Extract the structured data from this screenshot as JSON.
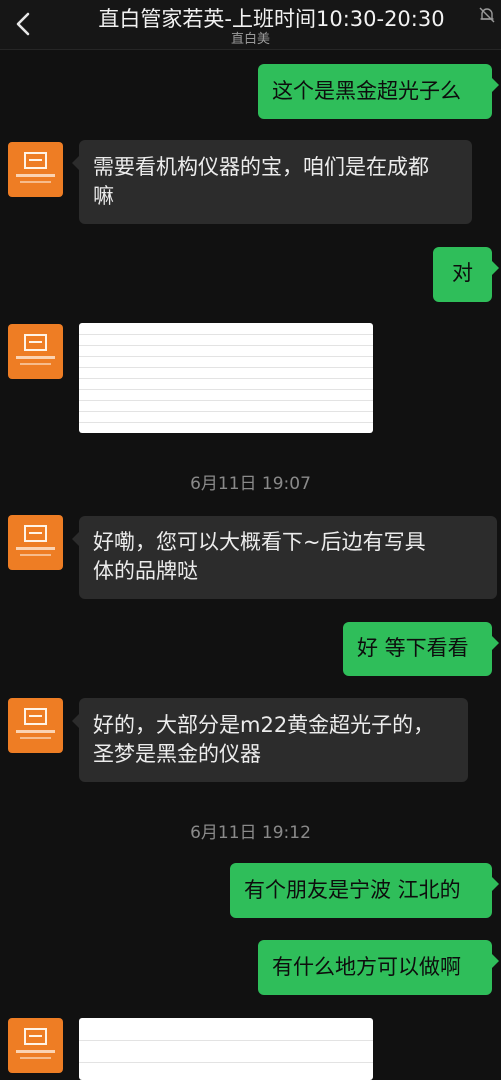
{
  "header": {
    "title": "直白管家若英-上班时间10:30-20:30",
    "subtitle": "直白美"
  },
  "icons": {
    "back": "chevron-left-icon",
    "mute": "bell-off-icon",
    "avatar": "brand-logo-avatar"
  },
  "colors": {
    "outgoing_bubble": "#2fbe5a",
    "incoming_bubble": "#2c2c2c",
    "avatar_bg": "#ee7d24",
    "background": "#111111"
  },
  "messages": {
    "m1": {
      "direction": "out",
      "text": "这个是黑金超光子么"
    },
    "m2": {
      "direction": "in",
      "line1": "需要看机构仪器的宝，咱们是在成都",
      "line2": "嘛"
    },
    "m3": {
      "direction": "out",
      "text": "对"
    },
    "m4": {
      "direction": "in",
      "type": "image"
    },
    "t1": {
      "type": "time",
      "text": "6月11日 19:07"
    },
    "m5": {
      "direction": "in",
      "line1": "好嘞，您可以大概看下~后边有写具",
      "line2": "体的品牌哒"
    },
    "m6": {
      "direction": "out",
      "text": "好 等下看看"
    },
    "m7": {
      "direction": "in",
      "line1": "好的，大部分是m22黄金超光子的，",
      "line2": "圣梦是黑金的仪器"
    },
    "t2": {
      "type": "time",
      "text": "6月11日 19:12"
    },
    "m8": {
      "direction": "out",
      "text": "有个朋友是宁波 江北的"
    },
    "m9": {
      "direction": "out",
      "text": "有什么地方可以做啊"
    },
    "m10": {
      "direction": "in",
      "type": "image"
    }
  }
}
